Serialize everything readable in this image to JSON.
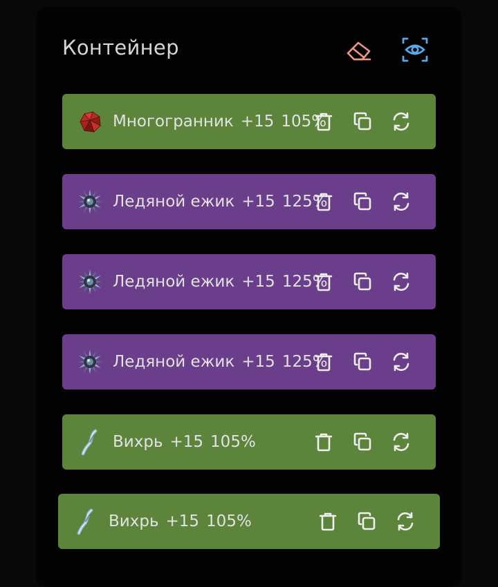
{
  "panel": {
    "title": "Контейнер",
    "clear_icon": "eraser-icon",
    "view_icon": "eye-scan-icon",
    "clear_color": "#e9968b",
    "view_color": "#5aa7e6"
  },
  "colors": {
    "green": "#5c843a",
    "purple": "#6a3e8a",
    "text": "#e2e2e2"
  },
  "items": [
    {
      "name": "Многогранник",
      "level": "+15",
      "percent": "105%",
      "color": "#5c843a",
      "icon": "polyhedron-icon"
    },
    {
      "name": "Ледяной ежик",
      "level": "+15",
      "percent": "125%",
      "color": "#6a3e8a",
      "icon": "ice-hedgehog-icon"
    },
    {
      "name": "Ледяной ежик",
      "level": "+15",
      "percent": "125%",
      "color": "#6a3e8a",
      "icon": "ice-hedgehog-icon"
    },
    {
      "name": "Ледяной ежик",
      "level": "+15",
      "percent": "125%",
      "color": "#6a3e8a",
      "icon": "ice-hedgehog-icon"
    },
    {
      "name": "Вихрь",
      "level": "+15",
      "percent": "105%",
      "color": "#5c843a",
      "icon": "whirlwind-icon"
    },
    {
      "name": "Вихрь",
      "level": "+15",
      "percent": "105%",
      "color": "#5c843a",
      "icon": "whirlwind-icon"
    }
  ],
  "row_actions": [
    "trash-icon",
    "duplicate-icon",
    "refresh-icon"
  ]
}
